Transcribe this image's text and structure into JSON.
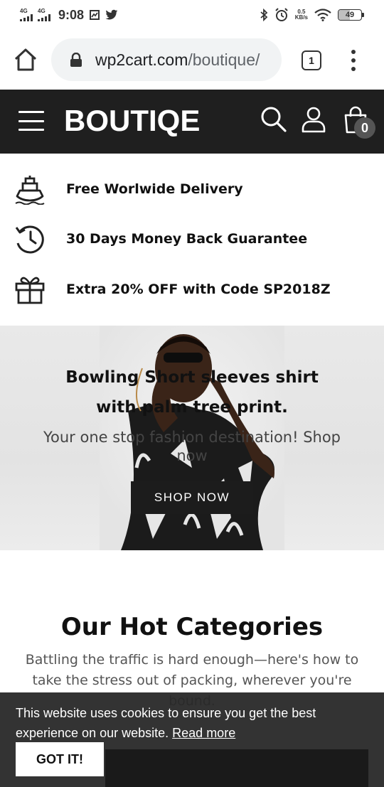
{
  "status_bar": {
    "sim1_label": "4G",
    "sim2_label": "4G",
    "time": "9:08",
    "net_speed_value": "0.5",
    "net_speed_unit": "KB/s",
    "battery_level": "49",
    "icons": [
      "signal-icon",
      "signal-icon",
      "screenshot-icon",
      "twitter-icon",
      "bluetooth-icon",
      "alarm-icon",
      "wifi-icon",
      "battery-icon"
    ]
  },
  "browser": {
    "url_domain": "wp2cart.com",
    "url_path": "/boutique/",
    "tab_count": "1"
  },
  "header": {
    "logo_text": "BOUTIQE",
    "cart_count": "0",
    "background": "#1f1f1f"
  },
  "features": [
    {
      "icon": "ship-icon",
      "text": "Free Worlwide Delivery"
    },
    {
      "icon": "history-icon",
      "text": "30 Days Money Back Guarantee"
    },
    {
      "icon": "gift-icon",
      "text": "Extra 20% OFF with Code SP2018Z"
    }
  ],
  "hero": {
    "title": "Bowling Short sleeves shirt with palm tree print.",
    "subtitle": "Your one stop fashion destination! Shop now",
    "button_label": "SHOP NOW"
  },
  "categories": {
    "title": "Our Hot Categories",
    "description": "Battling the traffic is hard enough—here's how to take the stress out of packing, wherever you're bound."
  },
  "cookie": {
    "message": "This website uses cookies to ensure you get the best experience on our website.",
    "link_label": "Read more",
    "button_label": "GOT IT!"
  }
}
